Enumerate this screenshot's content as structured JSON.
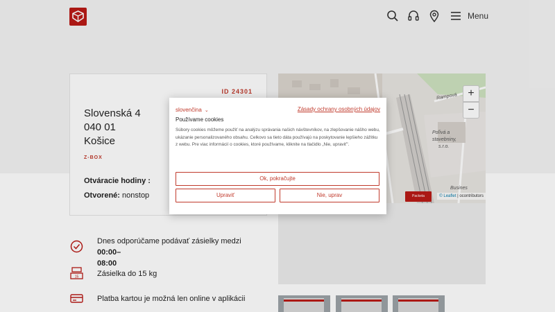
{
  "header": {
    "logo_icon": "packeta-logo-icon",
    "icons": [
      "search-icon",
      "headphones-icon",
      "location-pin-icon",
      "hamburger-menu-icon"
    ],
    "menu_label": "Menu",
    "brand_color": "#ba1b16"
  },
  "point": {
    "id": "ID 24301",
    "street": "Slovenská 4",
    "zip": "040 01",
    "city": "Košice",
    "type": "Z-BOX",
    "hours_label": "Otváracie hodiny :",
    "open_label": "Otvorené:",
    "open_value": "nonstop"
  },
  "map": {
    "zoom_in": "+",
    "zoom_out": "−",
    "badge": "Packeta",
    "attribution_leaflet": "© Leaflet",
    "attribution_osm": "ocontributors",
    "labels": {
      "rampova": "Rampová",
      "poliva": "Poľivá a",
      "stavebniny": "stavebniny,",
      "sro": "s.r.o.",
      "business": "Busines"
    }
  },
  "info": {
    "recommend_prefix": "Dnes odporúčame podávať zásielky medzi ",
    "recommend_time": "00:00–",
    "recommend_time2": "08:00",
    "weight": "Zásielka do 15 kg",
    "payment": "Platba kartou je možná len online v aplikácii",
    "icons": [
      "clock-check-icon",
      "weight-15kg-icon",
      "card-payment-icon"
    ]
  },
  "cookies": {
    "language": "slovenčina",
    "policy_link": "Zásady ochrany osobných údajov",
    "title": "Používame cookies",
    "body": "Súbory cookies môžeme použiť na analýzu správania našich návštevníkov, na zlepšovanie nášho webu, ukázanie personalizovaného obsahu. Celkovo sa tieto dáta používajú na poskytovanie lepšieho zážitku z webu. Pre viac informácií o cookies, ktoré používame, kliknite na tlačidlo „Nie, upraviť\".",
    "ok_button": "Ok, pokračujte",
    "customize_button": "Upraviť",
    "reject_button": "Nie, uprav"
  }
}
